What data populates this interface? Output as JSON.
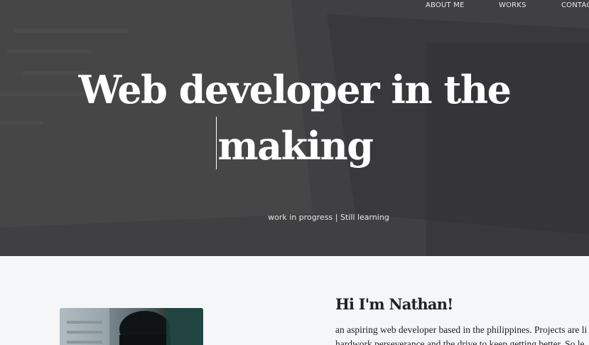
{
  "nav": {
    "items": [
      {
        "label": "ABOUT ME"
      },
      {
        "label": "WORKS"
      },
      {
        "label": "CONTAC"
      }
    ]
  },
  "hero": {
    "title_line1": "Web developer in the",
    "title_line2": "making",
    "subtitle": "work in progress | Still learning"
  },
  "about": {
    "heading": "Hi I'm Nathan!",
    "paragraph_line1": "an aspiring web developer based in the philippines. Projects are li",
    "paragraph_line2": "hardwork perseverance and the drive to keep getting better. So le"
  },
  "colors": {
    "hero_overlay": "#414143",
    "page_background": "#f5f6f8",
    "text_dark": "#222222",
    "text_light": "#ffffff"
  }
}
